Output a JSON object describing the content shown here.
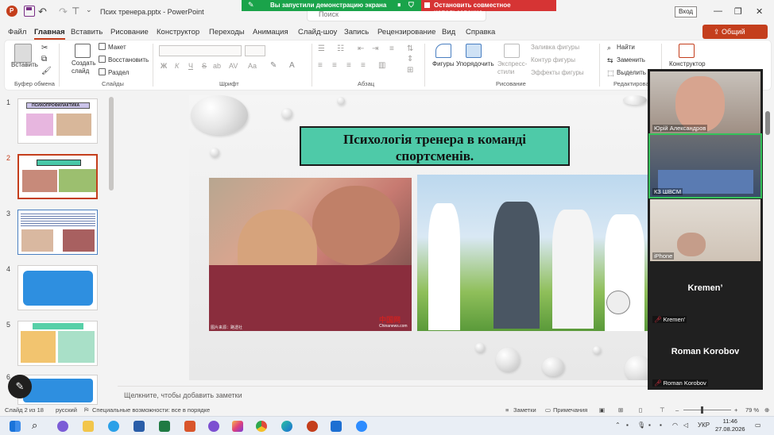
{
  "window": {
    "doc_title": "Псих тренера.pptx",
    "app_name": "PowerPoint",
    "search_placeholder": "Поиск",
    "signin_label": "Вход"
  },
  "screen_share": {
    "notice": "Вы запустили демонстрацию экрана",
    "stop_label": "Остановить совместное использование",
    "color_notice": "#1aa34a",
    "color_stop": "#d63434"
  },
  "ribbon_tabs": [
    {
      "label": "Файл",
      "active": false
    },
    {
      "label": "Главная",
      "active": true
    },
    {
      "label": "Вставить",
      "active": false
    },
    {
      "label": "Рисование",
      "active": false
    },
    {
      "label": "Конструктор",
      "active": false
    },
    {
      "label": "Переходы",
      "active": false
    },
    {
      "label": "Анимация",
      "active": false
    },
    {
      "label": "Слайд-шоу",
      "active": false
    },
    {
      "label": "Запись",
      "active": false
    },
    {
      "label": "Рецензирование",
      "active": false
    },
    {
      "label": "Вид",
      "active": false
    },
    {
      "label": "Справка",
      "active": false
    }
  ],
  "share_button": "Общий доступ",
  "ribbon": {
    "clipboard": {
      "paste": "Вставить",
      "group": "Буфер обмена"
    },
    "slides": {
      "new_slide": "Создать слайд",
      "layout": "Макет",
      "reset": "Восстановить",
      "section": "Раздел",
      "group": "Слайды"
    },
    "font": {
      "bold": "Ж",
      "italic": "К",
      "underline": "Ч",
      "strike": "S",
      "shadow": "ab",
      "spacing": "AV",
      "case": "Aa",
      "group": "Шрифт"
    },
    "paragraph": {
      "group": "Абзац"
    },
    "drawing": {
      "shapes": "Фигуры",
      "arrange": "Упорядочить",
      "quick_styles": "Экспресс-стили",
      "fill": "Заливка фигуры",
      "outline": "Контур фигуры",
      "effects": "Эффекты фигуры",
      "group": "Рисование"
    },
    "editing": {
      "find": "Найти",
      "replace": "Заменить",
      "select": "Выделить",
      "group": "Редактирование"
    },
    "designer": {
      "label": "Конструктор"
    }
  },
  "thumbnails": [
    {
      "num": "1",
      "title": "ПСИХОПРОФИЛАКТИКА"
    },
    {
      "num": "2",
      "title": "Психологія тренера в команді спортсменів."
    },
    {
      "num": "3",
      "title": ""
    },
    {
      "num": "4",
      "title": ""
    },
    {
      "num": "5",
      "title": ""
    },
    {
      "num": "6",
      "title": ""
    }
  ],
  "slide": {
    "title_line1": "Психологія тренера в команді",
    "title_line2": "спортсменів.",
    "photo1_watermark": "中国网",
    "photo1_watermark_sub": "Chinanews.com",
    "photo1_credit": "图片来源：路透社",
    "title_bg": "#4ecaa8"
  },
  "notes_placeholder": "Щелкните, чтобы добавить заметки",
  "participants": [
    {
      "name": "Юрій Александров",
      "video": true
    },
    {
      "name": "КЗ ШВСМ",
      "video": true,
      "active_speaker": true
    },
    {
      "name": "iPhone",
      "video": true
    },
    {
      "name": "Kremen'",
      "display": "Kremen’",
      "video": false,
      "muted": true
    },
    {
      "name": "Roman Korobov",
      "display": "Roman Korobov",
      "video": false,
      "muted": true
    }
  ],
  "status": {
    "slide_of": "Слайд 2 из 18",
    "language": "русский",
    "accessibility": "Специальные возможности: все в порядке",
    "notes": "Заметки",
    "comments": "Примечания",
    "zoom": "79 %"
  },
  "taskbar": {
    "lang": "УКР",
    "time": "11:46",
    "date": "27.08.2026"
  }
}
